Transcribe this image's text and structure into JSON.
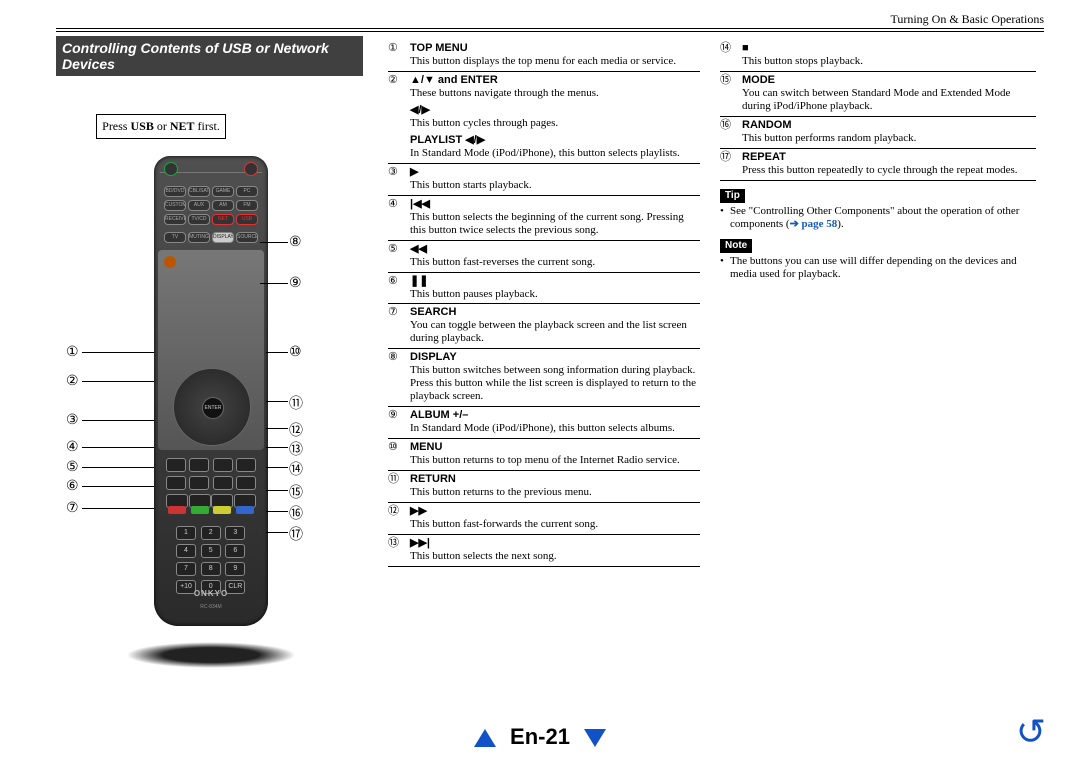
{
  "header": {
    "section": "Turning On & Basic Operations"
  },
  "title": "Controlling Contents of USB or Network Devices",
  "note_first": {
    "prefix": "Press ",
    "bold1": "USB",
    "mid": " or ",
    "bold2": "NET",
    "suffix": " first."
  },
  "footer": {
    "label": "En-21"
  },
  "remote": {
    "brand": "ONKYO",
    "model": "RC-834M"
  },
  "callouts_left": [
    "①",
    "②",
    "③",
    "④",
    "⑤",
    "⑥",
    "⑦"
  ],
  "callouts_right": [
    "⑧",
    "⑨",
    "⑩",
    "⑪",
    "⑫",
    "⑬",
    "⑭",
    "⑮",
    "⑯",
    "⑰"
  ],
  "mid": [
    {
      "num": "①",
      "heading": "TOP MENU",
      "desc": "This button displays the top menu for each media or service."
    },
    {
      "num": "②",
      "heading": "▲/▼ and ENTER",
      "desc": "These buttons navigate through the menus.",
      "sub": [
        {
          "heading": "◀/▶",
          "desc": "This button cycles through pages."
        },
        {
          "heading": "PLAYLIST ◀/▶",
          "desc": "In Standard Mode (iPod/iPhone), this button selects playlists."
        }
      ]
    },
    {
      "num": "③",
      "heading": "▶",
      "desc": "This button starts playback."
    },
    {
      "num": "④",
      "heading": "|◀◀",
      "desc": "This button selects the beginning of the current song. Pressing this button twice selects the previous song."
    },
    {
      "num": "⑤",
      "heading": "◀◀",
      "desc": "This button fast-reverses the current song."
    },
    {
      "num": "⑥",
      "heading": "❚❚",
      "desc": "This button pauses playback."
    },
    {
      "num": "⑦",
      "heading": "SEARCH",
      "desc": "You can toggle between the playback screen and the list screen during playback."
    },
    {
      "num": "⑧",
      "heading": "DISPLAY",
      "desc": "This button switches between song information during playback.",
      "desc2": "Press this button while the list screen is displayed to return to the playback screen."
    },
    {
      "num": "⑨",
      "heading": "ALBUM +/–",
      "desc": "In Standard Mode (iPod/iPhone), this button selects albums."
    },
    {
      "num": "⑩",
      "heading": "MENU",
      "desc": "This button returns to top menu of the Internet Radio service."
    },
    {
      "num": "⑪",
      "heading": "RETURN",
      "desc": "This button returns to the previous menu."
    },
    {
      "num": "⑫",
      "heading": "▶▶",
      "desc": "This button fast-forwards the current song."
    },
    {
      "num": "⑬",
      "heading": "▶▶|",
      "desc": "This button selects the next song."
    }
  ],
  "right": [
    {
      "num": "⑭",
      "heading": "■",
      "desc": "This button stops playback."
    },
    {
      "num": "⑮",
      "heading": "MODE",
      "desc": "You can switch between Standard Mode and Extended Mode during iPod/iPhone playback."
    },
    {
      "num": "⑯",
      "heading": "RANDOM",
      "desc": "This button performs random playback."
    },
    {
      "num": "⑰",
      "heading": "REPEAT",
      "desc": "Press this button repeatedly to cycle through the repeat modes."
    }
  ],
  "tip": {
    "label": "Tip",
    "text_before": "See \"Controlling Other Components\" about the operation of other components (",
    "link_arrow": "➔ ",
    "link_text": "page 58",
    "text_after": ")."
  },
  "note": {
    "label": "Note",
    "text": "The buttons you can use will differ depending on the devices and media used for playback."
  }
}
